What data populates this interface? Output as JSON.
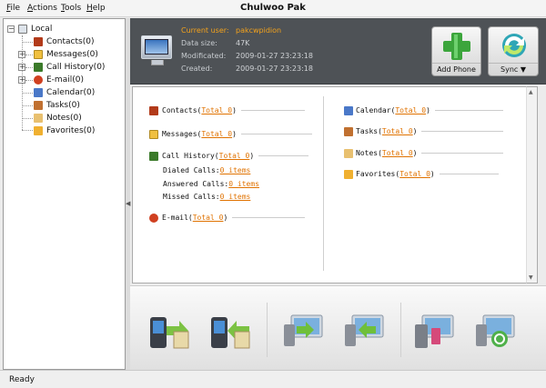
{
  "menu": {
    "items": [
      {
        "label": "File",
        "key": "F"
      },
      {
        "label": "Actions",
        "key": "A"
      },
      {
        "label": "Tools",
        "key": "T"
      },
      {
        "label": "Help",
        "key": "H"
      }
    ]
  },
  "window": {
    "title": "Chulwoo Pak"
  },
  "tree": {
    "root": "Local",
    "items": [
      {
        "label": "Contacts(0)",
        "icon": "contacts-icon"
      },
      {
        "label": "Messages(0)",
        "icon": "messages-icon"
      },
      {
        "label": "Call History(0)",
        "icon": "call-history-icon"
      },
      {
        "label": "E-mail(0)",
        "icon": "email-icon"
      },
      {
        "label": "Calendar(0)",
        "icon": "calendar-icon"
      },
      {
        "label": "Tasks(0)",
        "icon": "tasks-icon"
      },
      {
        "label": "Notes(0)",
        "icon": "notes-icon"
      },
      {
        "label": "Favorites(0)",
        "icon": "favorites-icon"
      }
    ]
  },
  "header": {
    "current_user_label": "Current user:",
    "current_user": "pakcwpidion",
    "data_size_label": "Data size:",
    "data_size": "47K",
    "modificated_label": "Modificated:",
    "modificated": "2009-01-27 23:23:18",
    "created_label": "Created:",
    "created": "2009-01-27 23:23:18",
    "add_phone": "Add Phone",
    "sync": "Sync"
  },
  "content": {
    "left": {
      "contacts": {
        "label": "Contacts",
        "link": "Total 0"
      },
      "messages": {
        "label": "Messages",
        "link": "Total 0"
      },
      "call_history": {
        "label": "Call History",
        "link": "Total 0"
      },
      "dialed": {
        "label": "Dialed Calls:",
        "link": "0 items"
      },
      "answered": {
        "label": "Answered Calls:",
        "link": "0 items"
      },
      "missed": {
        "label": "Missed Calls:",
        "link": "0 items"
      },
      "email": {
        "label": "E-mail",
        "link": "Total 0"
      }
    },
    "right": {
      "calendar": {
        "label": "Calendar",
        "link": "Total 0"
      },
      "tasks": {
        "label": "Tasks",
        "link": "Total 0"
      },
      "notes": {
        "label": "Notes",
        "link": "Total 0"
      },
      "favorites": {
        "label": "Favorites",
        "link": "Total 0"
      }
    }
  },
  "toolbar": {
    "buttons": [
      "phone-to-pc-icon",
      "pc-to-phone-icon",
      "export-icon",
      "import-icon",
      "delete-icon",
      "refresh-icon"
    ]
  },
  "status": {
    "text": "Ready"
  },
  "colors": {
    "link": "#e07200",
    "header_bg": "#4e5256",
    "accent_user": "#f3a21c"
  }
}
